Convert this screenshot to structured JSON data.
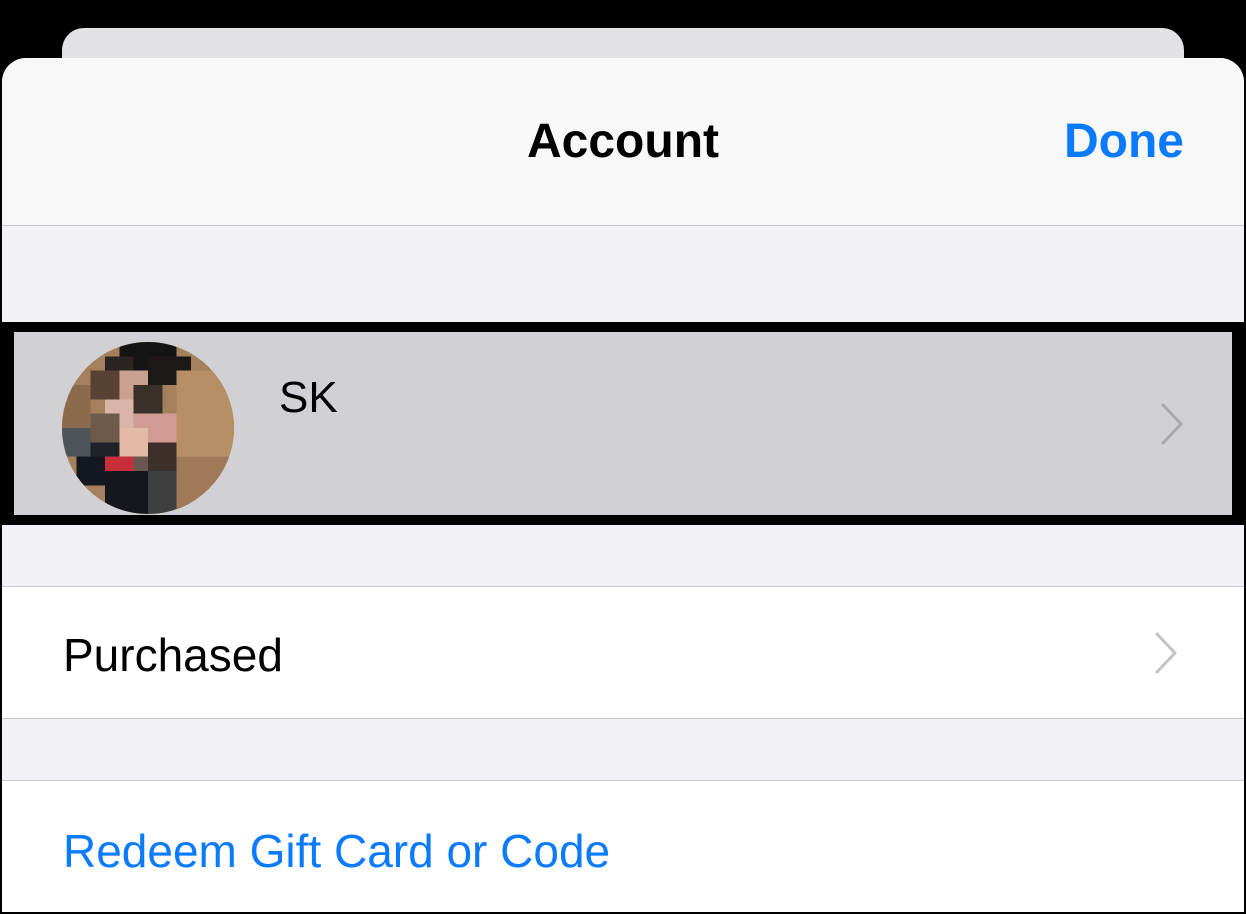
{
  "navbar": {
    "title": "Account",
    "done_label": "Done"
  },
  "account": {
    "name": "SK",
    "avatar_icon": "avatar-photo-pixelated",
    "chevron_icon": "chevron-right-icon"
  },
  "menu": {
    "purchased_label": "Purchased",
    "redeem_label": "Redeem Gift Card or Code"
  },
  "colors": {
    "accent": "#0a7aff",
    "background": "#f2f2f6",
    "selected_row": "#d1d0d5",
    "chevron": "#c4c4c7"
  }
}
